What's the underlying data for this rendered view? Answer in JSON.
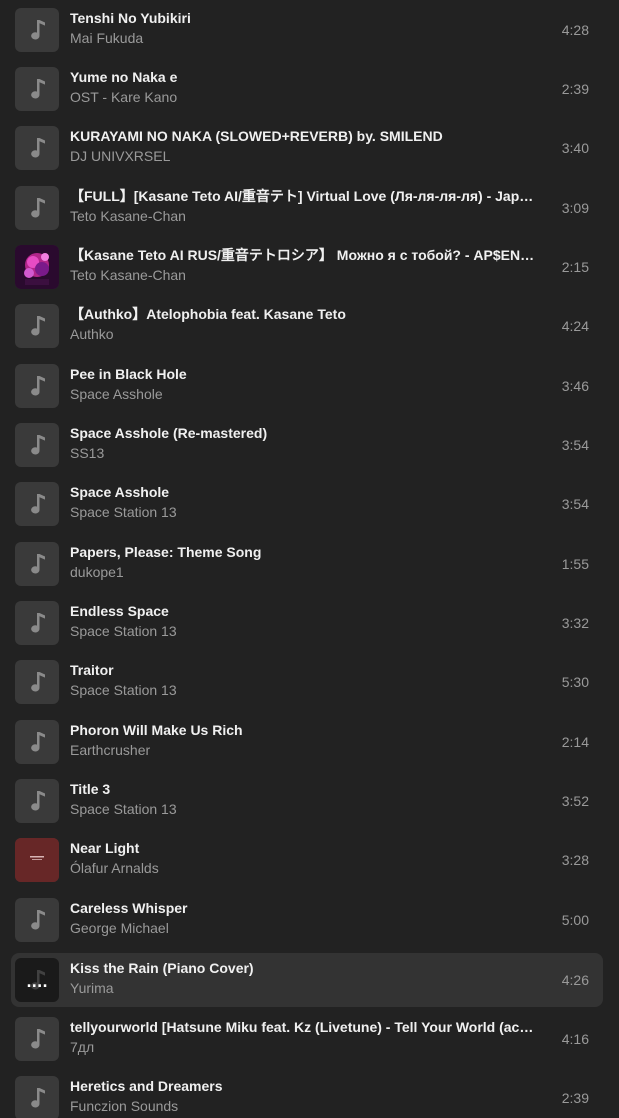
{
  "tracks": [
    {
      "title": "Tenshi No Yubikiri",
      "artist": "Mai Fukuda",
      "duration": "4:28",
      "cover": "music-note-icon"
    },
    {
      "title": "Yume no Naka e",
      "artist": "OST - Kare Kano",
      "duration": "2:39",
      "cover": "music-note-icon"
    },
    {
      "title": "KURAYAMI NO NAKA (SLOWED+REVERB) by. SMILEND",
      "artist": "DJ UNIVXRSEL",
      "duration": "3:40",
      "cover": "music-note-icon"
    },
    {
      "title": "【FULL】[Kasane Teto AI/重音テト] Virtual Love (Ля-ля-ля-ля) - Japanese Ver.",
      "artist": "Teto Kasane-Chan",
      "duration": "3:09",
      "cover": "music-note-icon"
    },
    {
      "title": "【Kasane Teto AI RUS/重音テトロシア】 Можно я с тобой? - AP$ENT (cover)",
      "artist": "Teto Kasane-Chan",
      "duration": "2:15",
      "cover": "album-art-pink"
    },
    {
      "title": "【Authko】Atelophobia feat. Kasane Teto",
      "artist": "Authko",
      "duration": "4:24",
      "cover": "music-note-icon"
    },
    {
      "title": "Pee in Black Hole",
      "artist": "Space Asshole",
      "duration": "3:46",
      "cover": "music-note-icon"
    },
    {
      "title": "Space Asshole (Re-mastered)",
      "artist": "SS13",
      "duration": "3:54",
      "cover": "music-note-icon"
    },
    {
      "title": "Space Asshole",
      "artist": "Space Station 13",
      "duration": "3:54",
      "cover": "music-note-icon"
    },
    {
      "title": "Papers, Please: Theme Song",
      "artist": "dukope1",
      "duration": "1:55",
      "cover": "music-note-icon"
    },
    {
      "title": "Endless Space",
      "artist": "Space Station 13",
      "duration": "3:32",
      "cover": "music-note-icon"
    },
    {
      "title": "Traitor",
      "artist": "Space Station 13",
      "duration": "5:30",
      "cover": "music-note-icon"
    },
    {
      "title": "Phoron Will Make Us Rich",
      "artist": "Earthcrusher",
      "duration": "2:14",
      "cover": "music-note-icon"
    },
    {
      "title": "Title 3",
      "artist": "Space Station 13",
      "duration": "3:52",
      "cover": "music-note-icon"
    },
    {
      "title": "Near Light",
      "artist": "Ólafur Arnalds",
      "duration": "3:28",
      "cover": "album-art-red"
    },
    {
      "title": "Careless Whisper",
      "artist": "George Michael",
      "duration": "5:00",
      "cover": "music-note-icon"
    },
    {
      "title": "Kiss the Rain (Piano Cover)",
      "artist": "Yurima",
      "duration": "4:26",
      "cover": "now-playing-icon",
      "active": true,
      "indicator": "...."
    },
    {
      "title": "tellyourworld [Hatsune Miku feat. Kz (Livetune) - Tell Your World (acoustic cover)",
      "artist": "7дл",
      "duration": "4:16",
      "cover": "music-note-icon"
    },
    {
      "title": "Heretics and Dreamers",
      "artist": "Funczion Sounds",
      "duration": "2:39",
      "cover": "music-note-icon"
    }
  ],
  "colors": {
    "background": "#222222",
    "active_row": "#333333",
    "cover_placeholder": "#3a3a3a",
    "title_text": "#f0f0f0",
    "secondary_text": "#9a9a9a"
  }
}
